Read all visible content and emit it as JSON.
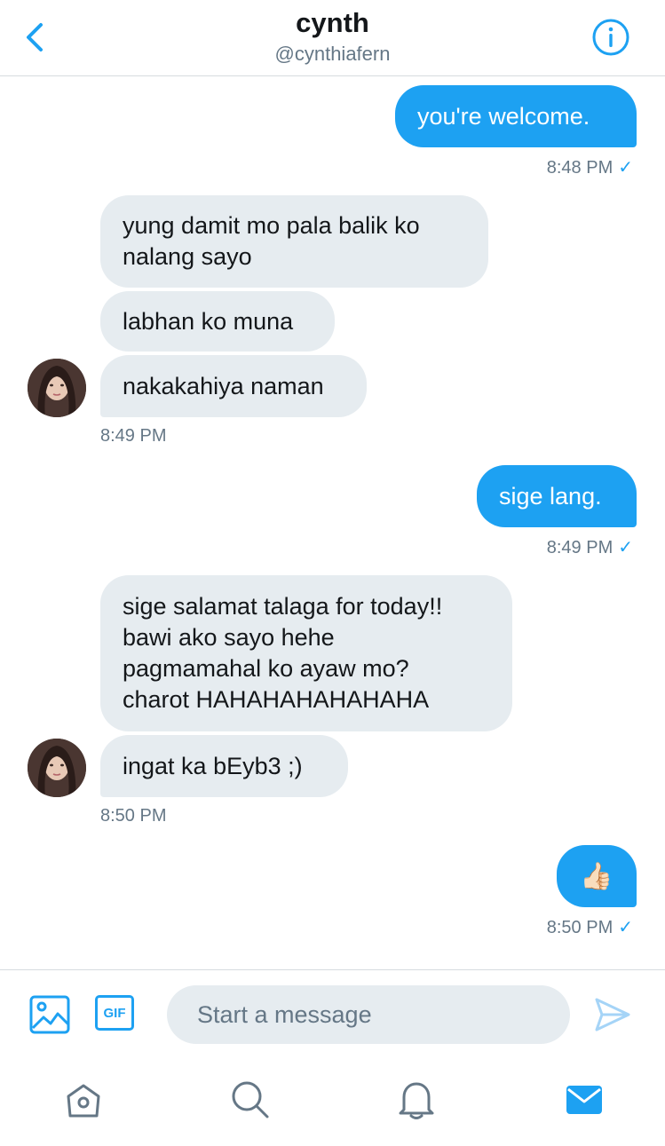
{
  "header": {
    "title": "cynth",
    "handle": "@cynthiafern"
  },
  "messages": [
    {
      "dir": "out",
      "text": "you're welcome.",
      "time": "8:48 PM"
    },
    {
      "dir": "in",
      "text1": "yung damit mo pala balik ko",
      "text2": "nalang sayo"
    },
    {
      "dir": "in",
      "text": "labhan ko muna"
    },
    {
      "dir": "in",
      "text": "nakakahiya naman",
      "time": "8:49 PM"
    },
    {
      "dir": "out",
      "text": "sige lang.",
      "time": "8:49 PM"
    },
    {
      "dir": "in",
      "lines": [
        "sige salamat talaga for today!!",
        "bawi ako sayo hehe",
        "pagmamahal ko ayaw mo?",
        "charot HAHAHAHAHAHAHA"
      ]
    },
    {
      "dir": "in",
      "text": "ingat ka bEyb3 ;)",
      "time": "8:50 PM"
    },
    {
      "dir": "out",
      "emoji": "👍🏻",
      "time": "8:50 PM"
    }
  ],
  "composer": {
    "placeholder": "Start a message",
    "gif_label": "GIF"
  },
  "colors": {
    "accent": "#1da1f2",
    "incoming_bg": "#e6ecf0",
    "muted": "#657786"
  }
}
